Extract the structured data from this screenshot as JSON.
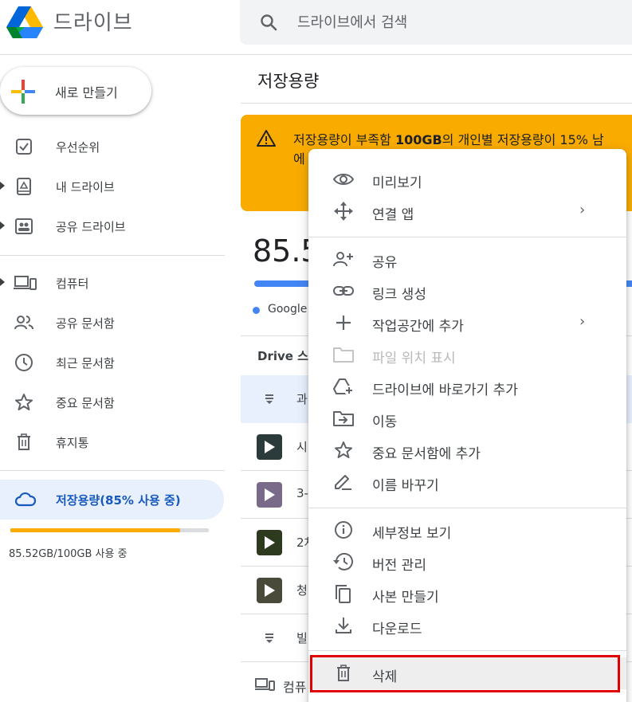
{
  "header": {
    "app_title": "드라이브",
    "search_placeholder": "드라이브에서 검색"
  },
  "sidebar": {
    "new_button_label": "새로 만들기",
    "items": [
      {
        "label": "우선순위",
        "icon": "priority-check-icon"
      },
      {
        "label": "내 드라이브",
        "icon": "my-drive-icon"
      },
      {
        "label": "공유 드라이브",
        "icon": "shared-drive-icon"
      },
      {
        "label": "컴퓨터",
        "icon": "computer-icon"
      },
      {
        "label": "공유 문서함",
        "icon": "people-icon"
      },
      {
        "label": "최근 문서함",
        "icon": "clock-icon"
      },
      {
        "label": "중요 문서함",
        "icon": "star-icon"
      },
      {
        "label": "휴지통",
        "icon": "trash-icon"
      }
    ],
    "storage": {
      "label": "저장용량(85% 사용 중)",
      "usage_text": "85.52GB/100GB 사용 중",
      "used_fraction": 0.8552
    }
  },
  "main": {
    "title": "저장용량",
    "warning": {
      "text_before": "저장용량이 부족함 ",
      "text_bold": "100GB",
      "text_after": "의 개인별 저장용량이 15% 남",
      "line2": "에"
    },
    "big_value": "85.5",
    "legend_label": "Google",
    "section_header": "Drive 스",
    "rows": [
      {
        "name": "과",
        "kind": "doc"
      },
      {
        "name": "시",
        "kind": "video"
      },
      {
        "name": "3-",
        "kind": "video"
      },
      {
        "name": "2차",
        "kind": "video"
      },
      {
        "name": "청",
        "kind": "video"
      },
      {
        "name": "빌",
        "kind": "doc"
      }
    ],
    "computer_row": "컴퓨"
  },
  "context_menu": {
    "items": [
      {
        "label": "미리보기",
        "icon": "eye-icon",
        "submenu": false,
        "disabled": false
      },
      {
        "label": "연결 앱",
        "icon": "move-arrows-icon",
        "submenu": true,
        "disabled": false
      },
      {
        "label": "공유",
        "icon": "person-add-icon",
        "submenu": false,
        "disabled": false
      },
      {
        "label": "링크 생성",
        "icon": "link-icon",
        "submenu": false,
        "disabled": false
      },
      {
        "label": "작업공간에 추가",
        "icon": "plus-icon",
        "submenu": true,
        "disabled": false
      },
      {
        "label": "파일 위치 표시",
        "icon": "folder-icon",
        "submenu": false,
        "disabled": true
      },
      {
        "label": "드라이브에 바로가기 추가",
        "icon": "drive-shortcut-icon",
        "submenu": false,
        "disabled": false
      },
      {
        "label": "이동",
        "icon": "move-to-folder-icon",
        "submenu": false,
        "disabled": false
      },
      {
        "label": "중요 문서함에 추가",
        "icon": "star-icon",
        "submenu": false,
        "disabled": false
      },
      {
        "label": "이름 바꾸기",
        "icon": "pencil-icon",
        "submenu": false,
        "disabled": false
      },
      {
        "label": "세부정보 보기",
        "icon": "info-icon",
        "submenu": false,
        "disabled": false
      },
      {
        "label": "버전 관리",
        "icon": "history-icon",
        "submenu": false,
        "disabled": false
      },
      {
        "label": "사본 만들기",
        "icon": "copy-icon",
        "submenu": false,
        "disabled": false
      },
      {
        "label": "다운로드",
        "icon": "download-icon",
        "submenu": false,
        "disabled": false
      },
      {
        "label": "삭제",
        "icon": "trash-icon",
        "submenu": false,
        "disabled": false
      }
    ],
    "submenu_arrow": "›"
  },
  "colors": {
    "warning_bg": "#f9ab00",
    "accent_blue": "#4285f4",
    "selected_bg": "#e8f0fe",
    "highlight_red": "#e00000"
  }
}
